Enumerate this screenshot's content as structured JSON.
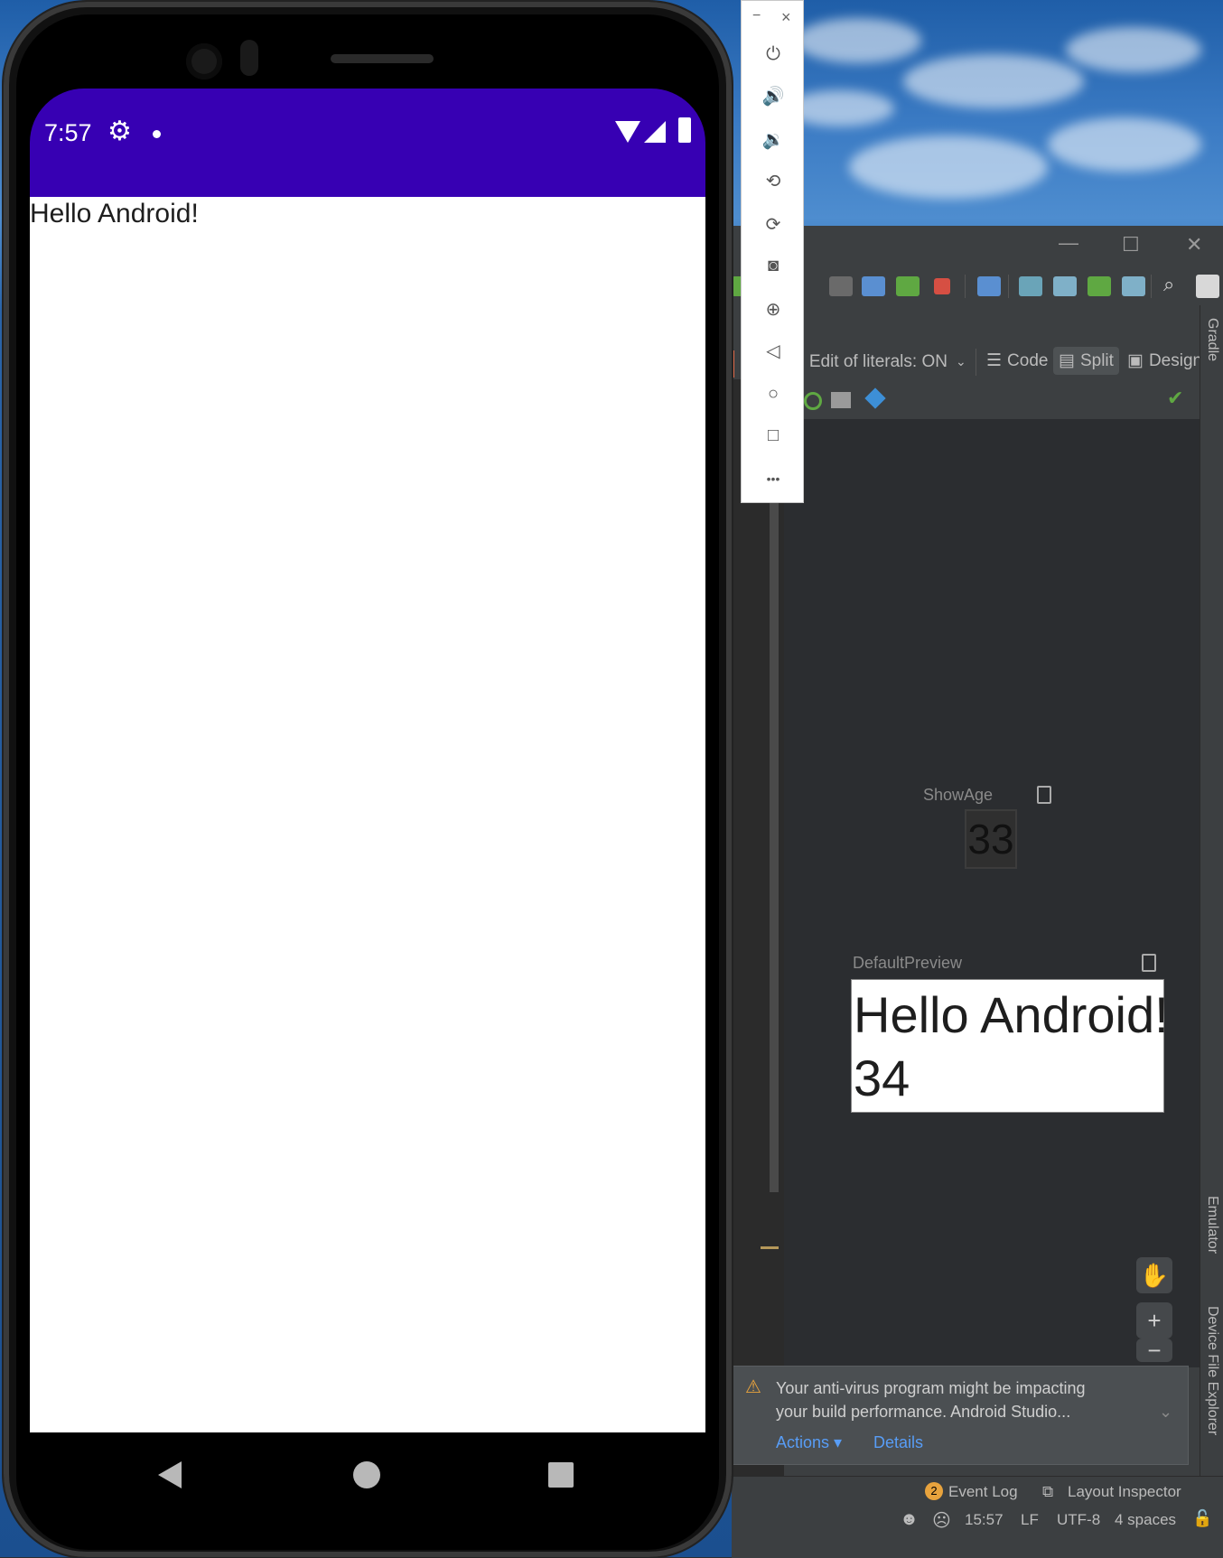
{
  "emulator": {
    "status_bar": {
      "time": "7:57"
    },
    "app_text": "Hello Android!",
    "nav": {
      "back": "back-icon",
      "home": "home-icon",
      "recents": "recents-icon"
    }
  },
  "emulator_panel": {
    "window_minimize": "−",
    "window_close": "×",
    "buttons": [
      "power-icon",
      "volume-up-icon",
      "volume-down-icon",
      "rotate-left-icon",
      "rotate-right-icon",
      "camera-icon",
      "zoom-icon",
      "back-icon",
      "home-icon",
      "overview-icon",
      "more-icon"
    ],
    "more_label": "•••"
  },
  "ide": {
    "window": {
      "minimize": "—",
      "maximize": "☐",
      "close": "✕"
    },
    "subbar": {
      "literals_label": "e Edit of literals: ON",
      "code_label": "Code",
      "split_label": "Split",
      "design_label": "Design"
    },
    "preview": {
      "show_age": {
        "label": "ShowAge",
        "value": "33"
      },
      "default_preview": {
        "label": "DefaultPreview",
        "line1": "Hello Android!",
        "line2": "34"
      }
    },
    "zoom": {
      "plus": "+",
      "minus": "−"
    },
    "notification": {
      "line1": "Your anti-virus program might be impacting",
      "line2": "your build performance. Android Studio...",
      "actions": "Actions ▾",
      "details": "Details"
    },
    "tool_windows": {
      "event_log_count": "2",
      "event_log": "Event Log",
      "layout_inspector": "Layout Inspector",
      "gradle": "Gradle",
      "emulator": "Emulator",
      "device_file_explorer": "Device File Explorer"
    },
    "status": {
      "position": "15:57",
      "line_sep": "LF",
      "encoding": "UTF-8",
      "indent": "4 spaces"
    }
  }
}
